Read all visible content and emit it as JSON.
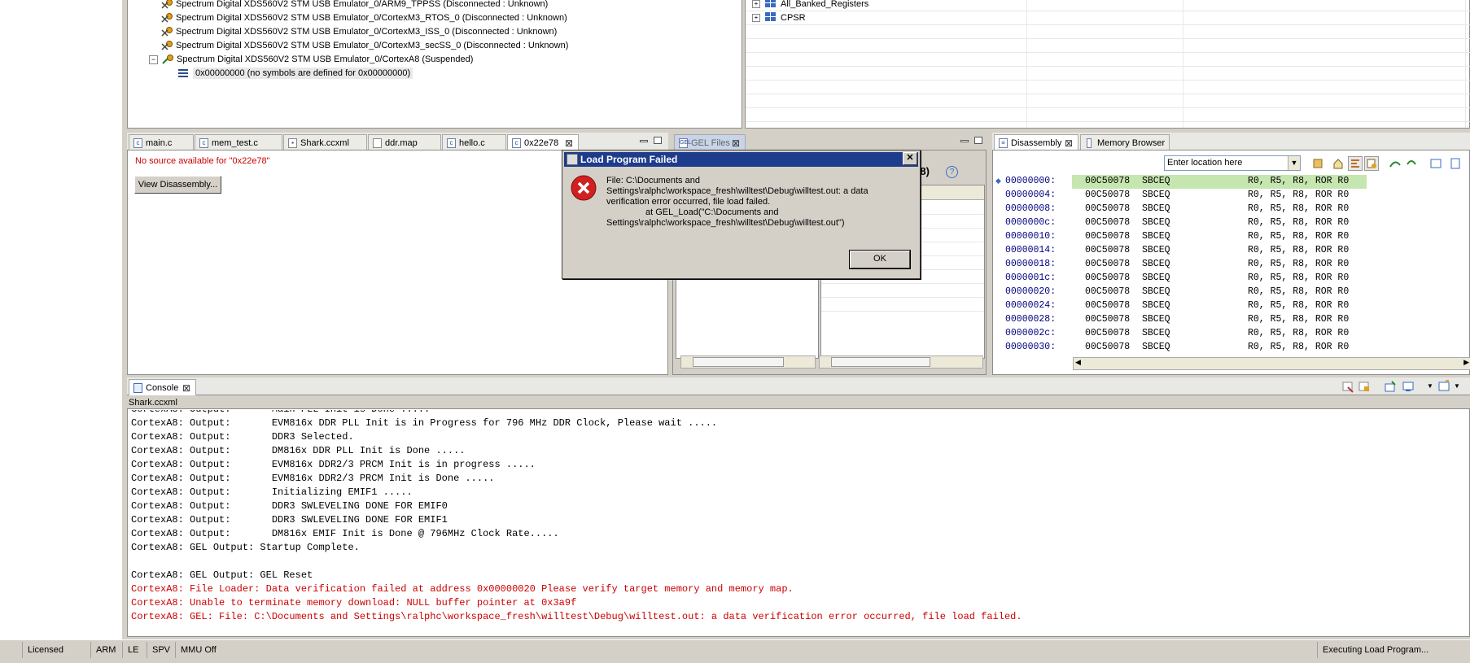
{
  "debug_tree": {
    "items": [
      {
        "label": "Spectrum Digital XDS560V2 STM USB Emulator_0/ARM9_TPPSS (Disconnected : Unknown)"
      },
      {
        "label": "Spectrum Digital XDS560V2 STM USB Emulator_0/CortexM3_RTOS_0 (Disconnected : Unknown)"
      },
      {
        "label": "Spectrum Digital XDS560V2 STM USB Emulator_0/CortexM3_ISS_0 (Disconnected : Unknown)"
      },
      {
        "label": "Spectrum Digital XDS560V2 STM USB Emulator_0/CortexM3_secSS_0 (Disconnected : Unknown)"
      },
      {
        "label": "Spectrum Digital XDS560V2 STM USB Emulator_0/CortexA8 (Suspended)"
      }
    ],
    "frame": "0x00000000  (no symbols are defined for 0x00000000)"
  },
  "registers": {
    "items": [
      {
        "label": "All_Banked_Registers"
      },
      {
        "label": "CPSR"
      }
    ]
  },
  "editor_tabs": [
    {
      "label": "main.c",
      "icon": "c-file-icon"
    },
    {
      "label": "mem_test.c",
      "icon": "c-file-icon"
    },
    {
      "label": "Shark.ccxml",
      "icon": "xml-file-icon"
    },
    {
      "label": "ddr.map",
      "icon": "file-icon"
    },
    {
      "label": "hello.c",
      "icon": "c-file-icon"
    },
    {
      "label": "0x22e78",
      "icon": "c-file-icon"
    }
  ],
  "editor": {
    "no_source": "No source available for \"0x22e78\"",
    "view_disasm_button": "View Disassembly..."
  },
  "gel": {
    "tab_label": "GEL Files",
    "partial_header": "A8)",
    "partial_cell": "gel"
  },
  "disassembly": {
    "tab_label": "Disassembly",
    "memory_tab_label": "Memory Browser",
    "location_placeholder": "Enter location here",
    "rows": [
      {
        "addr": "00000000:",
        "op": "00C50078",
        "mn": "SBCEQ",
        "args": "R0, R5, R8, ROR R0"
      },
      {
        "addr": "00000004:",
        "op": "00C50078",
        "mn": "SBCEQ",
        "args": "R0, R5, R8, ROR R0"
      },
      {
        "addr": "00000008:",
        "op": "00C50078",
        "mn": "SBCEQ",
        "args": "R0, R5, R8, ROR R0"
      },
      {
        "addr": "0000000c:",
        "op": "00C50078",
        "mn": "SBCEQ",
        "args": "R0, R5, R8, ROR R0"
      },
      {
        "addr": "00000010:",
        "op": "00C50078",
        "mn": "SBCEQ",
        "args": "R0, R5, R8, ROR R0"
      },
      {
        "addr": "00000014:",
        "op": "00C50078",
        "mn": "SBCEQ",
        "args": "R0, R5, R8, ROR R0"
      },
      {
        "addr": "00000018:",
        "op": "00C50078",
        "mn": "SBCEQ",
        "args": "R0, R5, R8, ROR R0"
      },
      {
        "addr": "0000001c:",
        "op": "00C50078",
        "mn": "SBCEQ",
        "args": "R0, R5, R8, ROR R0"
      },
      {
        "addr": "00000020:",
        "op": "00C50078",
        "mn": "SBCEQ",
        "args": "R0, R5, R8, ROR R0"
      },
      {
        "addr": "00000024:",
        "op": "00C50078",
        "mn": "SBCEQ",
        "args": "R0, R5, R8, ROR R0"
      },
      {
        "addr": "00000028:",
        "op": "00C50078",
        "mn": "SBCEQ",
        "args": "R0, R5, R8, ROR R0"
      },
      {
        "addr": "0000002c:",
        "op": "00C50078",
        "mn": "SBCEQ",
        "args": "R0, R5, R8, ROR R0"
      },
      {
        "addr": "00000030:",
        "op": "00C50078",
        "mn": "SBCEQ",
        "args": "R0, R5, R8, ROR R0"
      }
    ]
  },
  "console": {
    "tab_label": "Console",
    "source": "Shark.ccxml",
    "lines": [
      {
        "text": "CortexA8: Output:       Main PLL Init is Done .....",
        "err": false
      },
      {
        "text": "CortexA8: Output:       EVM816x DDR PLL Init is in Progress for 796 MHz DDR Clock, Please wait .....",
        "err": false
      },
      {
        "text": "CortexA8: Output:       DDR3 Selected.",
        "err": false
      },
      {
        "text": "CortexA8: Output:       DM816x DDR PLL Init is Done .....",
        "err": false
      },
      {
        "text": "CortexA8: Output:       EVM816x DDR2/3 PRCM Init is in progress .....",
        "err": false
      },
      {
        "text": "CortexA8: Output:       EVM816x DDR2/3 PRCM Init is Done .....",
        "err": false
      },
      {
        "text": "CortexA8: Output:       Initializing EMIF1 .....",
        "err": false
      },
      {
        "text": "CortexA8: Output:       DDR3 SWLEVELING DONE FOR EMIF0",
        "err": false
      },
      {
        "text": "CortexA8: Output:       DDR3 SWLEVELING DONE FOR EMIF1",
        "err": false
      },
      {
        "text": "CortexA8: Output:       DM816x EMIF Init is Done @ 796MHz Clock Rate.....",
        "err": false
      },
      {
        "text": "CortexA8: GEL Output: Startup Complete.",
        "err": false
      },
      {
        "text": "",
        "err": false
      },
      {
        "text": "CortexA8: GEL Output: GEL Reset",
        "err": false
      },
      {
        "text": "CortexA8: File Loader: Data verification failed at address 0x00000020 Please verify target memory and memory map.",
        "err": true
      },
      {
        "text": "CortexA8: Unable to terminate memory download: NULL buffer pointer at 0x3a9f",
        "err": true
      },
      {
        "text": "CortexA8: GEL: File: C:\\Documents and Settings\\ralphc\\workspace_fresh\\willtest\\Debug\\willtest.out: a data verification error occurred, file load failed.",
        "err": true
      }
    ]
  },
  "dialog": {
    "title": "Load Program Failed",
    "line1": "File: C:\\Documents and",
    "line2": "Settings\\ralphc\\workspace_fresh\\willtest\\Debug\\willtest.out: a data",
    "line3": "verification error occurred, file load failed.",
    "line4": "at GEL_Load(\"C:\\Documents and",
    "line5": "Settings\\ralphc\\workspace_fresh\\willtest\\Debug\\willtest.out\")",
    "ok_label": "OK"
  },
  "status_bar": {
    "licensed": "Licensed",
    "arm": "ARM",
    "le": "LE",
    "spv": "SPV",
    "mmu": "MMU Off",
    "progress": "Executing Load Program..."
  }
}
